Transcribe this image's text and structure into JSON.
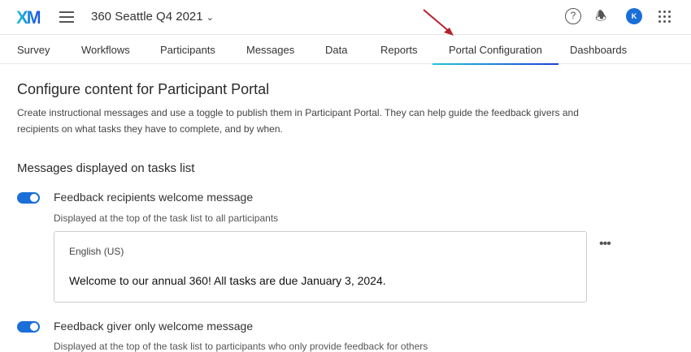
{
  "header": {
    "logo": "XM",
    "project": "360 Seattle Q4 2021",
    "help": "?",
    "avatar": "K"
  },
  "tabs": [
    "Survey",
    "Workflows",
    "Participants",
    "Messages",
    "Data",
    "Reports",
    "Portal Configuration",
    "Dashboards"
  ],
  "active_tab": "Portal Configuration",
  "page": {
    "title": "Configure content for Participant Portal",
    "description": "Create instructional messages and use a toggle to publish them in Participant Portal. They can help guide the feedback givers and recipients on what tasks they have to complete, and by when.",
    "section": "Messages displayed on tasks list"
  },
  "messages": [
    {
      "label": "Feedback recipients welcome message",
      "enabled": true,
      "sub": "Displayed at the top of the task list to all participants",
      "language": "English (US)",
      "text": "Welcome to our annual 360! All tasks are due January 3, 2024."
    },
    {
      "label": "Feedback giver only welcome message",
      "enabled": true,
      "sub": "Displayed at the top of the task list to participants who only provide feedback for others"
    }
  ],
  "more": "•••"
}
